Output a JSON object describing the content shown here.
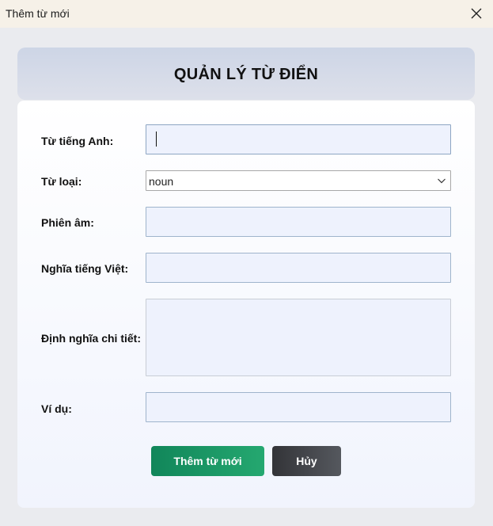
{
  "window": {
    "title": "Thêm từ mới"
  },
  "header": {
    "heading": "QUẢN LÝ TỪ ĐIỂN"
  },
  "form": {
    "english_word_label": "Từ tiếng Anh:",
    "english_word_value": "",
    "word_type_label": "Từ loại:",
    "word_type_value": "noun",
    "pronunciation_label": "Phiên âm:",
    "pronunciation_value": "",
    "vietnamese_meaning_label": "Nghĩa tiếng Việt:",
    "vietnamese_meaning_value": "",
    "detailed_definition_label": "Định nghĩa chi tiết:",
    "detailed_definition_value": "",
    "example_label": "Ví dụ:",
    "example_value": ""
  },
  "actions": {
    "add_label": "Thêm từ mới",
    "cancel_label": "Hủy"
  },
  "colors": {
    "title_bar_bg": "#f6f1e8",
    "window_bg": "#eaebef",
    "field_bg": "#eef2fd",
    "field_border": "#9fb4cc",
    "add_button": "#1a9866",
    "cancel_button": "#44464b"
  },
  "icons": {
    "close": "close-icon",
    "dropdown": "chevron-down-icon"
  }
}
